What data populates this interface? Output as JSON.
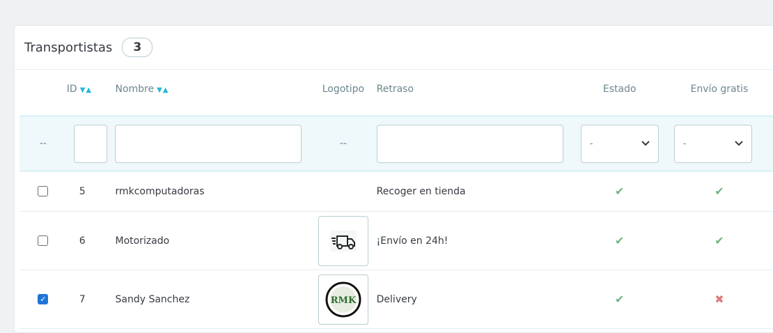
{
  "panel": {
    "title": "Transportistas",
    "count": "3"
  },
  "columns": {
    "id": "ID",
    "name": "Nombre",
    "logo": "Logotipo",
    "delay": "Retraso",
    "state": "Estado",
    "free": "Envío gratis"
  },
  "filters": {
    "check_placeholder": "--",
    "logo_placeholder": "--",
    "state_select_value": "-",
    "free_select_value": "-"
  },
  "rows": [
    {
      "id": "5",
      "name": "rmkcomputadoras",
      "delay": "Recoger en tienda",
      "checked": false,
      "logo_icon": "",
      "state": "ok",
      "free": "ok"
    },
    {
      "id": "6",
      "name": "Motorizado",
      "delay": "¡Envío en 24h!",
      "checked": false,
      "logo_icon": "delivery-truck-icon",
      "state": "ok",
      "free": "ok"
    },
    {
      "id": "7",
      "name": "Sandy Sanchez",
      "delay": "Delivery",
      "checked": true,
      "logo_icon": "rmk-logo-icon",
      "logo_text": "RMK",
      "state": "ok",
      "free": "no"
    }
  ],
  "colors": {
    "accent": "#25b9d7",
    "success": "#70b580",
    "danger": "#e17a7a",
    "checkbox_checked": "#1f74d8"
  }
}
